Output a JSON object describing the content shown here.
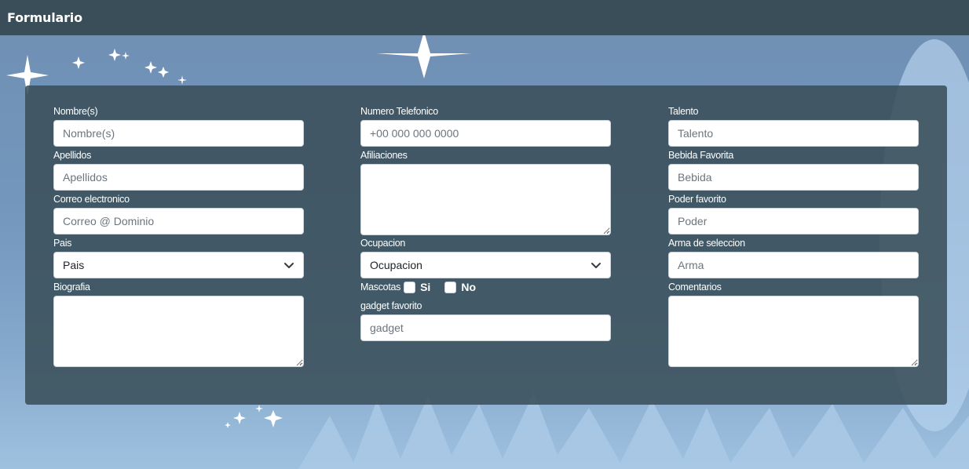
{
  "navbar": {
    "brand": "Formulario"
  },
  "form": {
    "nombre": {
      "label": "Nombre(s)",
      "placeholder": "Nombre(s)"
    },
    "apellidos": {
      "label": "Apellidos",
      "placeholder": "Apellidos"
    },
    "correo": {
      "label": "Correo electronico",
      "placeholder": "Correo @ Dominio"
    },
    "pais": {
      "label": "Pais",
      "selected": "Pais"
    },
    "biografia": {
      "label": "Biografia"
    },
    "telefono": {
      "label": "Numero Telefonico",
      "placeholder": "+00 000 000 0000"
    },
    "afiliaciones": {
      "label": "Afiliaciones"
    },
    "ocupacion": {
      "label": "Ocupacion",
      "selected": "Ocupacion"
    },
    "mascotas": {
      "label": "Mascotas",
      "si": "Si",
      "no": "No"
    },
    "gadget": {
      "label": "gadget favorito",
      "placeholder": "gadget"
    },
    "talento": {
      "label": "Talento",
      "placeholder": "Talento"
    },
    "bebida": {
      "label": "Bebida Favorita",
      "placeholder": "Bebida"
    },
    "poder": {
      "label": "Poder favorito",
      "placeholder": "Poder"
    },
    "arma": {
      "label": "Arma de seleccion",
      "placeholder": "Arma"
    },
    "comentarios": {
      "label": "Comentarios"
    }
  },
  "icons": {
    "select": "chevron-down-icon",
    "textarea": "resize-grip-icon",
    "background": "sparkle-icon"
  },
  "colors": {
    "navbar": "#394e58",
    "panel": "#394e58",
    "input_bg": "#ffffff",
    "label_text": "#ffffff",
    "background": "#7397bd"
  }
}
